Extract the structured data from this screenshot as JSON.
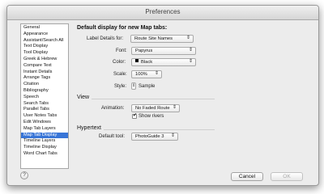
{
  "window": {
    "title": "Preferences"
  },
  "sidebar": {
    "items": [
      {
        "label": "General"
      },
      {
        "label": "Appearance"
      },
      {
        "label": "Assistant/Search All"
      },
      {
        "label": "Text Display"
      },
      {
        "label": "Tool Display"
      },
      {
        "label": "Greek & Hebrew"
      },
      {
        "label": "Compare Text"
      },
      {
        "label": "Instant Details"
      },
      {
        "label": "Arrange Tags"
      },
      {
        "label": "Citation"
      },
      {
        "label": "Bibliography"
      },
      {
        "label": "Speech"
      },
      {
        "label": "Search Tabs"
      },
      {
        "label": "Parallel Tabs"
      },
      {
        "label": "User Notes Tabs"
      },
      {
        "label": "Edit Windows"
      },
      {
        "label": "Map Tab Layers"
      },
      {
        "label": "Map Tab Display"
      },
      {
        "label": "Timeline Layers"
      },
      {
        "label": "Timeline Display"
      },
      {
        "label": "Word Chart Tabs"
      }
    ],
    "selected": "Map Tab Display"
  },
  "main": {
    "heading": "Default display for new Map tabs:",
    "label_details": {
      "label": "Label Details for:",
      "value": "Route Site Names"
    },
    "font": {
      "label": "Font:",
      "value": "Papyrus"
    },
    "color": {
      "label": "Color:",
      "value": "Black",
      "swatch": "#000000"
    },
    "scale": {
      "label": "Scale:",
      "value": "100%"
    },
    "style": {
      "label": "Style:",
      "value": "Sample"
    },
    "view": {
      "section": "View",
      "animation": {
        "label": "Animation:",
        "value": "No Faded Route"
      },
      "show_rivers": {
        "label": "Show rivers",
        "checked": true
      }
    },
    "hypertext": {
      "section": "Hypertext",
      "default_tool": {
        "label": "Default tool:",
        "value": "PhotoGuide 3"
      }
    }
  },
  "footer": {
    "help": "?",
    "cancel": "Cancel",
    "ok": "OK"
  }
}
